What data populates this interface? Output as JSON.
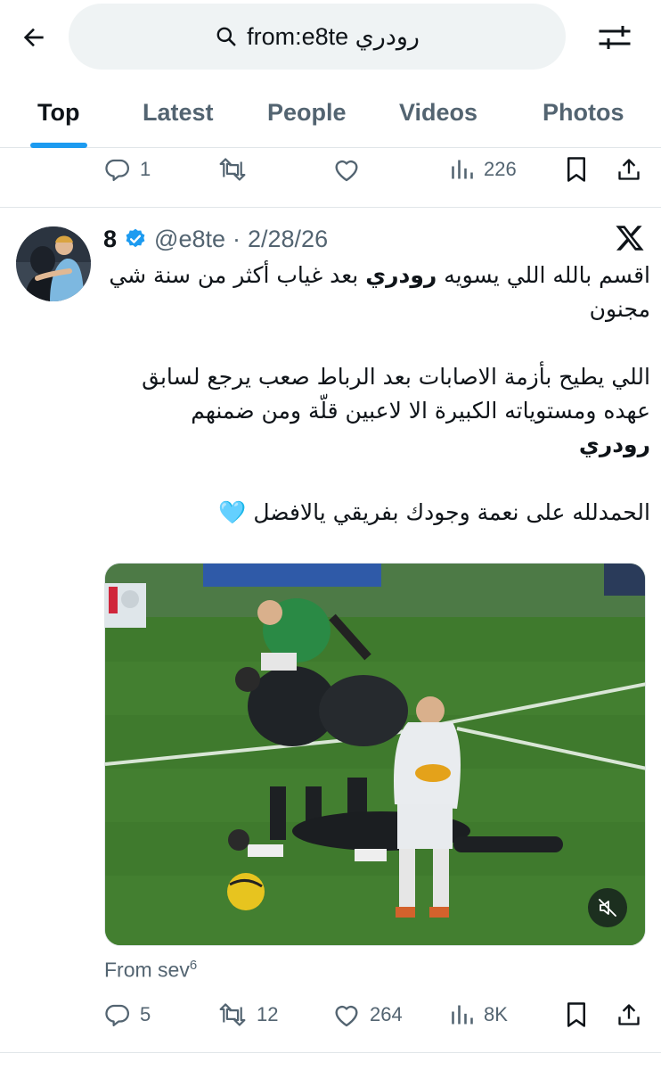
{
  "search": {
    "query": "from:e8te رودري"
  },
  "tabs": [
    {
      "label": "Top",
      "active": true
    },
    {
      "label": "Latest",
      "active": false
    },
    {
      "label": "People",
      "active": false
    },
    {
      "label": "Videos",
      "active": false
    },
    {
      "label": "Photos",
      "active": false
    }
  ],
  "previous_tweet_actions": {
    "replies": "1",
    "reposts": "",
    "likes": "",
    "views": "226"
  },
  "tweet": {
    "display_name": "8",
    "verified": true,
    "handle": "@e8te",
    "separator": "·",
    "date": "2/28/26",
    "text": {
      "p1_before": "اقسم بالله اللي يسويه ",
      "p1_bold": "رودري",
      "p1_after": " بعد غياب أكثر من سنة شي مجنون",
      "p2": "اللي يطيح بأزمة الاصابات بعد الرباط صعب يرجع لسابق عهده ومستوياته الكبيرة الا لاعبين قلّة ومن ضمنهم",
      "p2_bold": "رودري",
      "p3": "الحمدلله على نعمة وجودك بفريقي يالافضل",
      "p3_emoji": "🩵"
    },
    "media": {
      "type": "video",
      "muted": true
    },
    "source": {
      "prefix": "From sev",
      "sup": "6"
    },
    "actions": {
      "replies": "5",
      "reposts": "12",
      "likes": "264",
      "views": "8K"
    }
  },
  "colors": {
    "accent": "#1d9bf0",
    "text_primary": "#0f1419",
    "text_secondary": "#536471",
    "search_bg": "#eff3f4",
    "border": "#e1e6e9",
    "pitch_green": "#3e7a2c"
  },
  "icons": {
    "back": "arrow-left-icon",
    "search": "search-icon",
    "filter": "sliders-icon",
    "reply": "reply-icon",
    "repost": "repost-icon",
    "like": "heart-icon",
    "views": "bar-chart-icon",
    "bookmark": "bookmark-icon",
    "share": "share-icon",
    "verified": "verified-badge-icon",
    "x_logo": "x-logo-icon",
    "mute": "muted-speaker-icon"
  }
}
